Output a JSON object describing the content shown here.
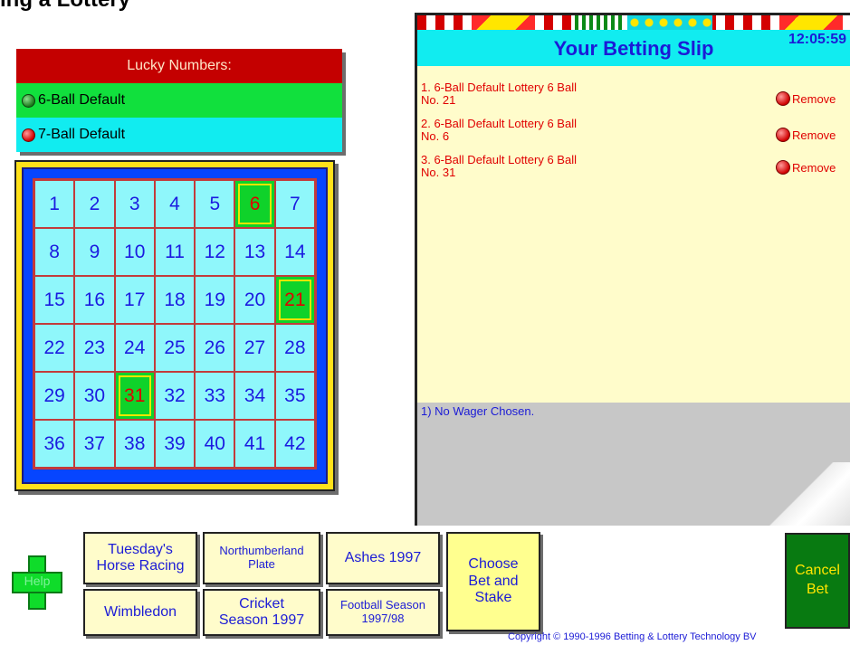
{
  "page_title": "ing a Lottery",
  "lucky_panel": {
    "title": "Lucky Numbers:",
    "options": [
      {
        "label": "6-Ball Default",
        "ball_color": "green"
      },
      {
        "label": "7-Ball Default",
        "ball_color": "red"
      }
    ]
  },
  "number_grid": {
    "numbers": [
      1,
      2,
      3,
      4,
      5,
      6,
      7,
      8,
      9,
      10,
      11,
      12,
      13,
      14,
      15,
      16,
      17,
      18,
      19,
      20,
      21,
      22,
      23,
      24,
      25,
      26,
      27,
      28,
      29,
      30,
      31,
      32,
      33,
      34,
      35,
      36,
      37,
      38,
      39,
      40,
      41,
      42
    ],
    "selected": [
      6,
      21,
      31
    ]
  },
  "slip": {
    "title": "Your Betting Slip",
    "time": "12:05:59",
    "bets": [
      {
        "line1": "1. 6-Ball Default  Lottery 6 Ball",
        "line2": "No. 21"
      },
      {
        "line1": "2. 6-Ball Default  Lottery 6 Ball",
        "line2": "No. 6"
      },
      {
        "line1": "3. 6-Ball Default  Lottery 6 Ball",
        "line2": "No. 31"
      }
    ],
    "remove_label": "Remove",
    "wager_text": "1) No Wager Chosen."
  },
  "buttons": {
    "help": "Help",
    "tuesday_line1": "Tuesday's",
    "tuesday_line2": "Horse Racing",
    "wimbledon": "Wimbledon",
    "northumberland_line1": "Northumberland",
    "northumberland_line2": "Plate",
    "cricket_line1": "Cricket",
    "cricket_line2": "Season 1997",
    "ashes": "Ashes 1997",
    "football_line1": "Football Season",
    "football_line2": "1997/98",
    "choose_line1": "Choose",
    "choose_line2": "Bet and",
    "choose_line3": "Stake",
    "cancel_line1": "Cancel",
    "cancel_line2": "Bet"
  },
  "copyright": "Copyright © 1990-1996 Betting & Lottery Technology BV"
}
